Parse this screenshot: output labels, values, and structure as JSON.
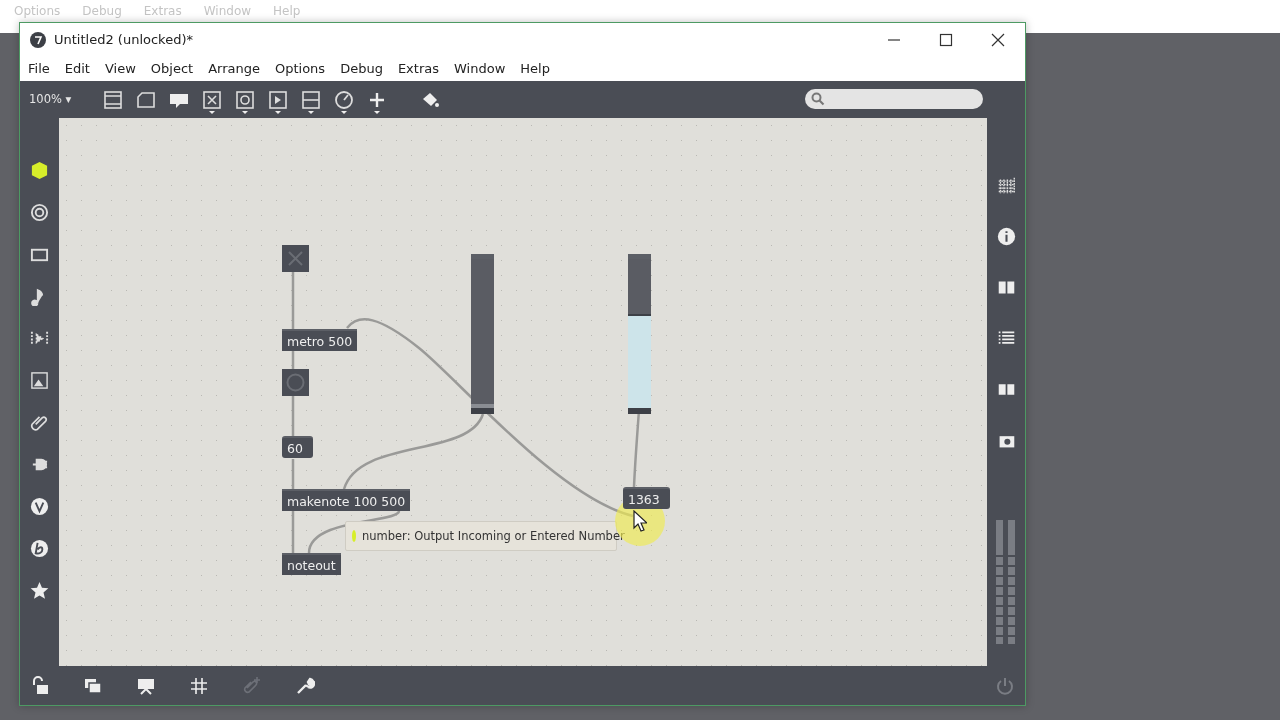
{
  "background_menu": [
    "Options",
    "Debug",
    "Extras",
    "Window",
    "Help"
  ],
  "window": {
    "title": "Untitled2 (unlocked)*"
  },
  "menu": [
    "File",
    "Edit",
    "View",
    "Object",
    "Arrange",
    "Options",
    "Debug",
    "Extras",
    "Window",
    "Help"
  ],
  "toolbar": {
    "zoom": "100% ▾"
  },
  "patch": {
    "objects": [
      {
        "kind": "toggle",
        "on": false
      },
      {
        "kind": "slider",
        "level": 0.03
      },
      {
        "kind": "slider",
        "level": 0.62
      },
      {
        "kind": "object",
        "text": "metro 500"
      },
      {
        "kind": "bang"
      },
      {
        "kind": "number",
        "text": "60"
      },
      {
        "kind": "object",
        "text": "makenote 100 500"
      },
      {
        "kind": "number",
        "text": "1363"
      },
      {
        "kind": "object",
        "text": "noteout"
      }
    ],
    "tooltip": "number: Output Incoming or Entered Number"
  }
}
